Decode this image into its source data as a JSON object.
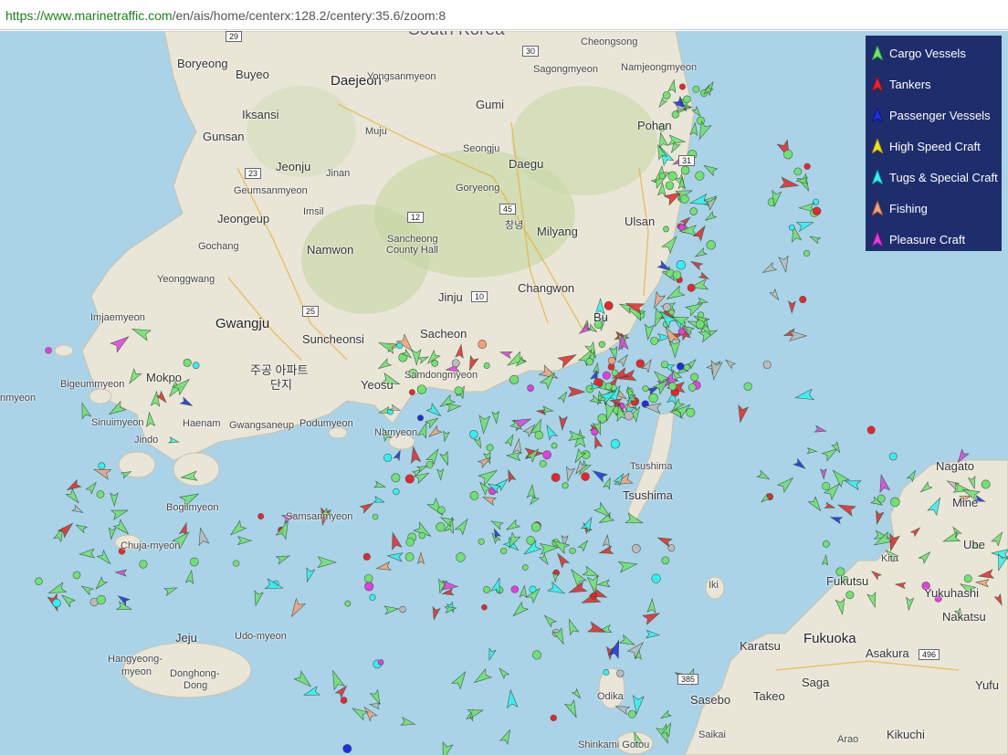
{
  "browser": {
    "url_prefix": "https://www.marinetraffic.com",
    "url_path": "/en/ais/home/centerx:128.2/centery:35.6/zoom:8"
  },
  "legend": {
    "items": [
      {
        "label": "Cargo Vessels",
        "color": "#6ee36e"
      },
      {
        "label": "Tankers",
        "color": "#e8262a"
      },
      {
        "label": "Passenger Vessels",
        "color": "#1a2fe0"
      },
      {
        "label": "High Speed Craft",
        "color": "#f5e21b"
      },
      {
        "label": "Tugs & Special Craft",
        "color": "#2ef2f2"
      },
      {
        "label": "Fishing",
        "color": "#f5a07a"
      },
      {
        "label": "Pleasure Craft",
        "color": "#e23ee0"
      }
    ]
  },
  "places": {
    "south_korea": "South Korea",
    "boryeong": "Boryeong",
    "buyeo": "Buyeo",
    "daejeon": "Daejeon",
    "yongsanmyeon": "Yongsanmyeon",
    "gumi": "Gumi",
    "cheongsong": "Cheongsong",
    "sagongmyeon": "Sagongmyeon",
    "namjeong": "Namjeongmyeon",
    "iksansi": "Iksansi",
    "gunsan": "Gunsan",
    "muju": "Muju",
    "seongju": "Seongju",
    "daegu": "Daegu",
    "pohang": "Pohan",
    "jeonju": "Jeonju",
    "jinan": "Jinan",
    "geumsan": "Geumsanmyeon",
    "goryeong": "Goryeong",
    "imsil": "Imsil",
    "jeongeup": "Jeongeup",
    "sancheong": "Sancheong",
    "county_hall": "County Hall",
    "changnyeong": "창녕",
    "milyang": "Milyang",
    "ulsan": "Ulsan",
    "gochang": "Gochang",
    "namwon": "Namwon",
    "yeonggwang": "Yeonggwang",
    "jinju": "Jinju",
    "changwon": "Changwon",
    "imjae": "Imjaemyeon",
    "gwangju": "Gwangju",
    "suncheon": "Suncheonsi",
    "sacheon": "Sacheon",
    "busan": "Bu",
    "apt1": "주공 아파트",
    "apt2": "단지",
    "mokpo": "Mokpo",
    "bigeum": "Bigeummyeon",
    "yeosu": "Yeosu",
    "samdong": "Samdongmyeon",
    "namyeon": "Namyeon",
    "nmyeon": "nmyeon",
    "sinui": "Sinuimyeon",
    "jindo": "Jindo",
    "haenam": "Haenam",
    "gwangsaneup": "Gwangsaneup",
    "podu": "Podumyeon",
    "bogil": "Bogilmyeon",
    "samsan": "Samsanmyeon",
    "chuja": "Chuja-myeon",
    "tsushima_jp": "Tsushima",
    "tsushima": "Tsushima",
    "nagato": "Nagato",
    "mine": "Mine",
    "ube": "Ube",
    "iki": "Iki",
    "fukutsu": "Fukutsu",
    "yukuhashi": "Yukuhashi",
    "nakatsu": "Nakatsu",
    "fukuoka": "Fukuoka",
    "jeju": "Jeju",
    "udo": "Udo-myeon",
    "hangyeong": "Hangyeong-",
    "hangyeong2": "myeon",
    "donghong": "Donghong-",
    "donghong2": "Dong",
    "karatsu": "Karatsu",
    "asakura": "Asakura",
    "saga": "Saga",
    "odika": "Odika",
    "sasebo": "Sasebo",
    "takeo": "Takeo",
    "yufu": "Yufu",
    "shinkamigotou": "Shinkami Gotou",
    "saikai": "Saikai",
    "arao": "Arao",
    "kikuchi": "Kikuchi",
    "kita": "Kita"
  },
  "roads": {
    "r29": "29",
    "r30": "30",
    "r23": "23",
    "r12": "12",
    "r45": "45",
    "r31": "31",
    "r10": "10",
    "r25": "25",
    "r496": "496",
    "r385": "385"
  }
}
